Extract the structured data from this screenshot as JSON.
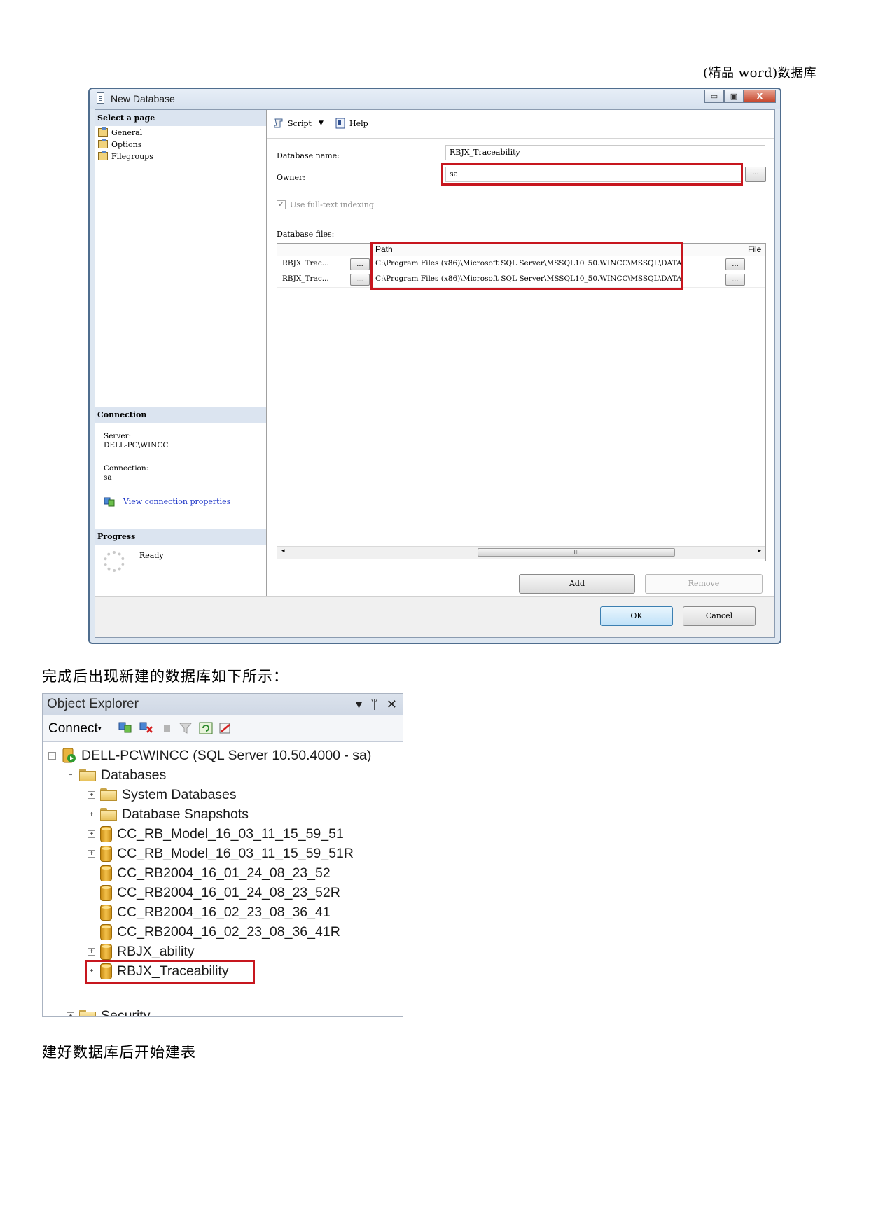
{
  "doc": {
    "header": "(精品 word)数据库",
    "caption1": "完成后出现新建的数据库如下所示：",
    "caption2": "建好数据库后开始建表"
  },
  "dialog": {
    "title": "New Database",
    "window_buttons": [
      "▭",
      "▣",
      "X"
    ],
    "left_panel": {
      "select_page_heading": "Select a page",
      "pages": [
        "General",
        "Options",
        "Filegroups"
      ],
      "connection_heading": "Connection",
      "server_label": "Server:",
      "server_value": "DELL-PC\\WINCC",
      "connection_label": "Connection:",
      "connection_value": "sa",
      "view_properties_link": "View connection properties",
      "progress_heading": "Progress",
      "progress_status": "Ready"
    },
    "toolbar": {
      "script_label": "Script",
      "help_label": "Help"
    },
    "form": {
      "database_name_label": "Database name:",
      "database_name_value": "RBJX_Traceability",
      "owner_label": "Owner:",
      "owner_value": "sa",
      "browse_label": "...",
      "fulltext_label": "Use full-text indexing",
      "fulltext_checked": true,
      "database_files_label": "Database files:"
    },
    "files_grid": {
      "columns": [
        "Path",
        "File"
      ],
      "rows": [
        {
          "logical_name": "RBJX_Trac...",
          "path": "C:\\Program Files (x86)\\Microsoft SQL Server\\MSSQL10_50.WINCC\\MSSQL\\DATA"
        },
        {
          "logical_name": "RBJX_Trac...",
          "path": "C:\\Program Files (x86)\\Microsoft SQL Server\\MSSQL10_50.WINCC\\MSSQL\\DATA"
        }
      ],
      "scroll_thumb_label": "III"
    },
    "buttons": {
      "add": "Add",
      "remove": "Remove",
      "ok": "OK",
      "cancel": "Cancel"
    },
    "colors": {
      "highlight": "#c7161e",
      "section_bg": "#dbe4f0",
      "link": "#1d35c7"
    }
  },
  "object_explorer": {
    "title": "Object Explorer",
    "title_buttons": [
      "▾",
      "ᛘ",
      "✕"
    ],
    "connect_label": "Connect",
    "toolbar_icons": [
      "connect-icon",
      "disconnect-icon",
      "stop-icon",
      "filter-icon",
      "refresh-icon",
      "summary-icon"
    ],
    "server_node": "DELL-PC\\WINCC (SQL Server 10.50.4000 - sa)",
    "databases_node": "Databases",
    "items": [
      {
        "label": "System Databases",
        "kind": "folder",
        "expandable": true
      },
      {
        "label": "Database Snapshots",
        "kind": "folder",
        "expandable": true
      },
      {
        "label": "CC_RB_Model_16_03_11_15_59_51",
        "kind": "db",
        "expandable": true
      },
      {
        "label": "CC_RB_Model_16_03_11_15_59_51R",
        "kind": "db",
        "expandable": true
      },
      {
        "label": "CC_RB2004_16_01_24_08_23_52",
        "kind": "db",
        "expandable": false
      },
      {
        "label": "CC_RB2004_16_01_24_08_23_52R",
        "kind": "db",
        "expandable": false
      },
      {
        "label": "CC_RB2004_16_02_23_08_36_41",
        "kind": "db",
        "expandable": false
      },
      {
        "label": "CC_RB2004_16_02_23_08_36_41R",
        "kind": "db",
        "expandable": false
      },
      {
        "label": "RBJX_ability",
        "kind": "db",
        "expandable": true
      },
      {
        "label": "RBJX_Traceability",
        "kind": "db",
        "expandable": true
      }
    ],
    "partial_node": "Security"
  }
}
